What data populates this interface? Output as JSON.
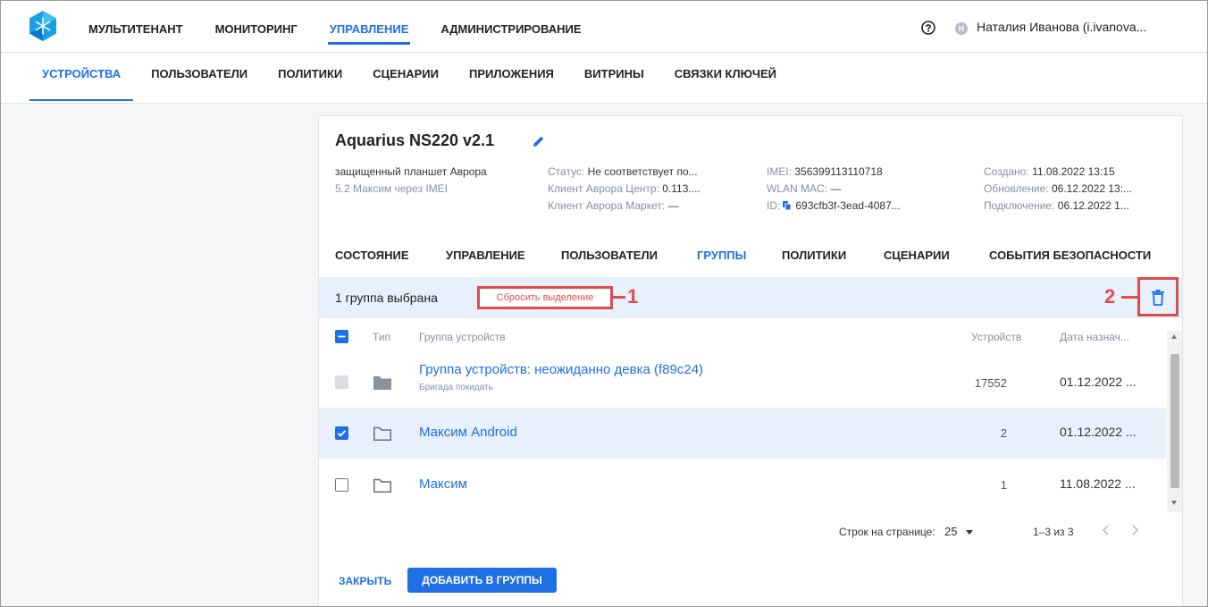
{
  "topnav": {
    "items": [
      "МУЛЬТИТЕНАНТ",
      "МОНИТОРИНГ",
      "УПРАВЛЕНИЕ",
      "АДМИНИСТРИРОВАНИЕ"
    ],
    "active_index": 2,
    "user_initial": "Н",
    "user_name": "Наталия Иванова (i.ivanova..."
  },
  "subnav": {
    "items": [
      "УСТРОЙСТВА",
      "ПОЛЬЗОВАТЕЛИ",
      "ПОЛИТИКИ",
      "СЦЕНАРИИ",
      "ПРИЛОЖЕНИЯ",
      "ВИТРИНЫ",
      "СВЯЗКИ КЛЮЧЕЙ"
    ],
    "active_index": 0
  },
  "device": {
    "title": "Aquarius NS220 v2.1",
    "desc_line1": "защищенный планшет Аврора",
    "desc_line2": "5.2 Максим через IMEI",
    "status_label": "Статус:",
    "status_value": "Не соответствует по...",
    "client_center_label": "Клиент Аврора Центр:",
    "client_center_value": "0.113....",
    "client_market_label": "Клиент Аврора Маркет:",
    "client_market_value": "—",
    "imei_label": "IMEI:",
    "imei_value": "356399113110718",
    "wlan_label": "WLAN MAC:",
    "wlan_value": "—",
    "id_label": "ID:",
    "id_value": "693cfb3f-3ead-4087...",
    "created_label": "Создано:",
    "created_value": "11.08.2022 13:15",
    "updated_label": "Обновление:",
    "updated_value": "06.12.2022 13:...",
    "connected_label": "Подключение:",
    "connected_value": "06.12.2022 1..."
  },
  "tabs": {
    "items": [
      "СОСТОЯНИЕ",
      "УПРАВЛЕНИЕ",
      "ПОЛЬЗОВАТЕЛИ",
      "ГРУППЫ",
      "ПОЛИТИКИ",
      "СЦЕНАРИИ",
      "СОБЫТИЯ БЕЗОПАСНОСТИ"
    ],
    "active_index": 3
  },
  "selection": {
    "count_text": "1 группа выбрана",
    "reset_label": "Сбросить выделение",
    "marker1": "1",
    "marker2": "2"
  },
  "table": {
    "headers": {
      "type": "Тип",
      "group": "Группа устройств",
      "devices": "Устройств",
      "date": "Дата назнач..."
    },
    "rows": [
      {
        "name": "Группа устройств: неожиданно девка (f89c24)",
        "sub": "Бригада покидать",
        "devices": "17552",
        "date": "01.12.2022 ...",
        "checked": "disabled"
      },
      {
        "name": "Максим Android",
        "sub": "",
        "devices": "2",
        "date": "01.12.2022 ...",
        "checked": "checked"
      },
      {
        "name": "Максим",
        "sub": "",
        "devices": "1",
        "date": "11.08.2022 ...",
        "checked": "unchecked"
      }
    ]
  },
  "pagination": {
    "rows_per_page_label": "Строк на странице:",
    "rows_per_page_value": "25",
    "range_text": "1–3 из 3"
  },
  "actions": {
    "close_label": "ЗАКРЫТЬ",
    "add_label": "ДОБАВИТЬ В ГРУППЫ"
  },
  "colors": {
    "accent": "#1f6fe5",
    "highlight": "#e04b4b",
    "selected_row": "#e8f0fc"
  }
}
